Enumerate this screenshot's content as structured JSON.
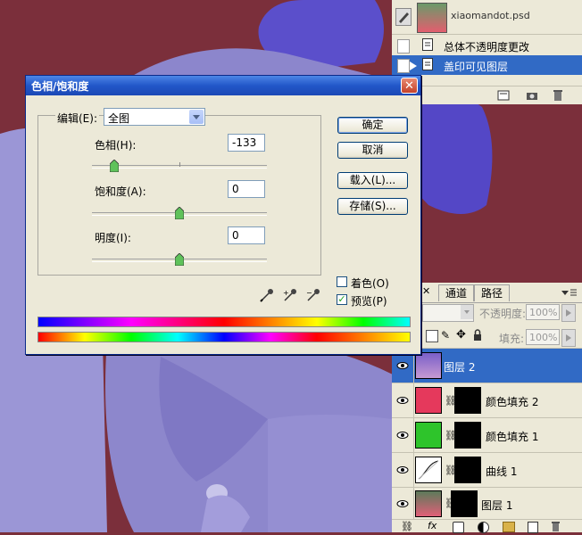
{
  "dialog": {
    "title": "色相/饱和度",
    "close_glyph": "✕",
    "edit_label": "编辑(E):",
    "edit_value": "全图",
    "hue_label": "色相(H):",
    "hue_value": "-133",
    "hue_position": 0.13,
    "saturation_label": "饱和度(A):",
    "saturation_value": "0",
    "saturation_position": 0.5,
    "lightness_label": "明度(I):",
    "lightness_value": "0",
    "lightness_position": 0.5,
    "ok_label": "确定",
    "cancel_label": "取消",
    "load_label": "载入(L)...",
    "save_label": "存储(S)...",
    "colorize_label": "着色(O)",
    "colorize_checked": false,
    "preview_label": "预览(P)",
    "preview_checked": true,
    "check_glyph": "✓"
  },
  "history_panel": {
    "snapshot_name": "xiaomandot.psd",
    "items": [
      {
        "label": "总体不透明度更改"
      },
      {
        "label": "盖印可见图层"
      }
    ],
    "selected_index": 1
  },
  "layers_panel": {
    "tabs": [
      "通道",
      "路径"
    ],
    "opacity_label": "不透明度:",
    "opacity_value": "100%",
    "fill_label": "填充:",
    "fill_value": "100%",
    "layers": [
      {
        "name": "图层 2",
        "selected": true
      },
      {
        "name": "颜色填充 2",
        "selected": false,
        "thumb_color": "#e5395c"
      },
      {
        "name": "颜色填充 1",
        "selected": false,
        "thumb_color": "#2ec42b"
      },
      {
        "name": "曲线 1",
        "selected": false
      },
      {
        "name": "图层 1",
        "selected": false
      }
    ]
  },
  "colors": {
    "background": "#7a2f3a",
    "skin": "#8f89cf",
    "glove": "#5a4ec8",
    "selection": "#316ac5",
    "title_bar": "#2257c9"
  }
}
